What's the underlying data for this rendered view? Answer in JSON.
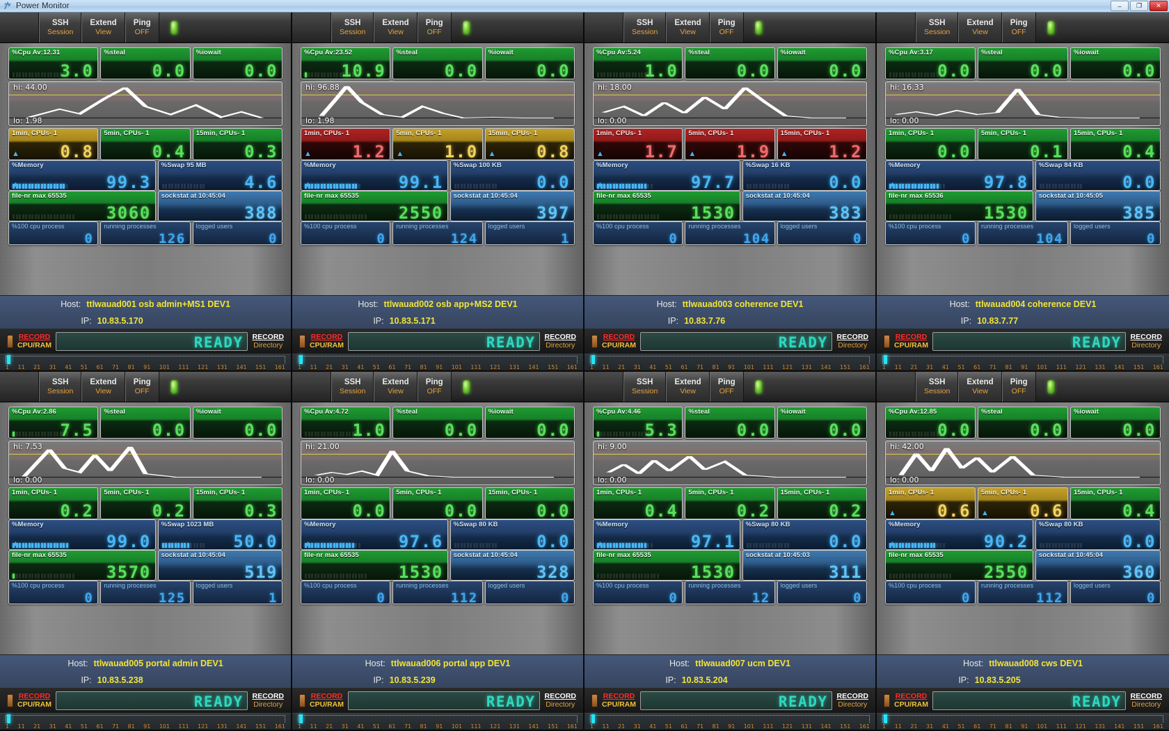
{
  "window": {
    "title": "Power Monitor",
    "icon": "app-icon",
    "buttons": {
      "minimize": "–",
      "maximize": "❐",
      "close": "✕"
    }
  },
  "menu": {
    "items": [
      {
        "top": "SSH",
        "bottom": "Session",
        "name": "ssh-session"
      },
      {
        "top": "Extend",
        "bottom": "View",
        "name": "extend-view"
      },
      {
        "top": "Ping",
        "bottom": "OFF",
        "name": "ping-toggle"
      }
    ],
    "led": "status-led"
  },
  "labels": {
    "steal": "%steal",
    "iowait": "%iowait",
    "load1": "1min, CPUs- 1",
    "load5": "5min, CPUs- 1",
    "load15": "15min, CPUs- 1",
    "memory": "%Memory",
    "cpu100": "%100 cpu process",
    "running": "running processes",
    "logged": "logged users",
    "host": "Host:",
    "ip": "IP:",
    "record_cpu_a": "RECORD",
    "record_cpu_b": "CPU/RAM",
    "record_dir_a": "RECORD",
    "record_dir_b": "Directory",
    "ready": "READY"
  },
  "ruler": {
    "ticks": [
      "1",
      "11",
      "21",
      "31",
      "41",
      "51",
      "61",
      "71",
      "81",
      "91",
      "101",
      "111",
      "121",
      "131",
      "141",
      "151",
      "161"
    ]
  },
  "colors": {
    "green": "#57e05a",
    "yellow": "#f3d25c",
    "red": "#f06a6a",
    "blue": "#49b6f5",
    "accent_yellow": "#f2e536",
    "ready_teal": "#2fd8c0",
    "record_red": "#ff2d2d"
  },
  "panels": [
    {
      "cpu_cap": "%Cpu Av:12.31",
      "cpu_val": "3.0",
      "cpu_bars": 0,
      "cpu_theme": "t-green",
      "steal": "0.0",
      "iowait": "0.0",
      "hi": "hi: 44.00",
      "lo": "lo: 1.98",
      "spark": "4,52 10,40 14,47 19,24 23,8 27,36 32,48 37,34 42,52 46,44 50,53",
      "load": [
        {
          "val": "0.8",
          "theme": "t-yellow",
          "warn": true
        },
        {
          "val": "0.4",
          "theme": "t-green",
          "warn": false
        },
        {
          "val": "0.3",
          "theme": "t-green",
          "warn": false
        }
      ],
      "mem_cap": "%Memory",
      "mem_val": "99.3",
      "mem_bars": 17,
      "mem_warn": true,
      "swap_cap": "%Swap 95 MB",
      "swap_val": "4.6",
      "swap_bars": 0,
      "file_cap": "file-nr max 65535",
      "file_val": "3060",
      "file_bars": 0,
      "sock_cap": "sockstat at 10:45:04",
      "sock_val": "388",
      "cpu100": "0",
      "running": "126",
      "logged": "0",
      "host": "ttlwauad001 osb admin+MS1 DEV1",
      "ip": "10.83.5.170"
    },
    {
      "cpu_cap": "%Cpu Av:23.52",
      "cpu_val": "10.9",
      "cpu_bars": 1,
      "cpu_theme": "t-green",
      "steal": "0.0",
      "iowait": "0.0",
      "hi": "hi: 96.88",
      "lo": "lo: 1.98",
      "spark": "4,50 7,24 9,6 12,30 16,48 20,52 24,36 28,46 32,53 38,52 44,53 50,53",
      "load": [
        {
          "val": "1.2",
          "theme": "t-red",
          "warn": true
        },
        {
          "val": "1.0",
          "theme": "t-yellow",
          "warn": true
        },
        {
          "val": "0.8",
          "theme": "t-yellow",
          "warn": true
        }
      ],
      "mem_cap": "%Memory",
      "mem_val": "99.1",
      "mem_bars": 17,
      "mem_warn": true,
      "swap_cap": "%Swap 100 KB",
      "swap_val": "0.0",
      "swap_bars": 0,
      "file_cap": "file-nr max 65535",
      "file_val": "2550",
      "file_bars": 0,
      "sock_cap": "sockstat at 10:45:04",
      "sock_val": "397",
      "cpu100": "0",
      "running": "124",
      "logged": "1",
      "host": "ttlwauad002 osb app+MS2 DEV1",
      "ip": "10.83.5.171"
    },
    {
      "cpu_cap": "%Cpu Av:5.24",
      "cpu_val": "1.0",
      "cpu_bars": 0,
      "cpu_theme": "t-green",
      "steal": "0.0",
      "iowait": "0.0",
      "hi": "hi: 18.00",
      "lo": "lo: 0.00",
      "spark": "2,45 6,36 10,50 14,30 18,46 22,22 26,40 30,8 34,30 38,50 43,53 50,53",
      "load": [
        {
          "val": "1.7",
          "theme": "t-red",
          "warn": true
        },
        {
          "val": "1.9",
          "theme": "t-red",
          "warn": true
        },
        {
          "val": "1.2",
          "theme": "t-red",
          "warn": true
        }
      ],
      "mem_cap": "%Memory",
      "mem_val": "97.7",
      "mem_bars": 16,
      "mem_warn": true,
      "swap_cap": "%Swap 16 KB",
      "swap_val": "0.0",
      "swap_bars": 0,
      "file_cap": "file-nr max 65535",
      "file_val": "1530",
      "file_bars": 0,
      "sock_cap": "sockstat at 10:45:04",
      "sock_val": "383",
      "cpu100": "0",
      "running": "104",
      "logged": "0",
      "host": "ttlwauad003 coherence DEV1",
      "ip": "10.83.7.76"
    },
    {
      "cpu_cap": "%Cpu Av:3.17",
      "cpu_val": "0.0",
      "cpu_bars": 0,
      "cpu_theme": "t-green",
      "steal": "0.0",
      "iowait": "0.0",
      "hi": "hi: 16.33",
      "lo": "lo: 0.00",
      "spark": "2,48 6,44 10,49 14,42 18,48 22,45 26,10 30,48 34,52 40,53 46,53 50,53",
      "load": [
        {
          "val": "0.0",
          "theme": "t-green",
          "warn": false
        },
        {
          "val": "0.1",
          "theme": "t-green",
          "warn": false
        },
        {
          "val": "0.4",
          "theme": "t-green",
          "warn": false
        }
      ],
      "mem_cap": "%Memory",
      "mem_val": "97.8",
      "mem_bars": 16,
      "mem_warn": true,
      "swap_cap": "%Swap 84 KB",
      "swap_val": "0.0",
      "swap_bars": 0,
      "file_cap": "file-nr max 65536",
      "file_val": "1530",
      "file_bars": 0,
      "sock_cap": "sockstat at 10:45:05",
      "sock_val": "385",
      "cpu100": "0",
      "running": "104",
      "logged": "0",
      "host": "ttlwauad004 coherence DEV1",
      "ip": "10.83.7.77"
    },
    {
      "cpu_cap": "%Cpu Av:2.86",
      "cpu_val": "7.5",
      "cpu_bars": 1,
      "cpu_theme": "t-green",
      "steal": "0.0",
      "iowait": "0.0",
      "hi": "hi: 7.53",
      "lo": "lo: 0.00",
      "spark": "3,52 5,36 8,12 11,40 14,46 17,20 20,44 24,8 27,48 33,53 41,53 50,53",
      "load": [
        {
          "val": "0.2",
          "theme": "t-green",
          "warn": false
        },
        {
          "val": "0.2",
          "theme": "t-green",
          "warn": false
        },
        {
          "val": "0.3",
          "theme": "t-green",
          "warn": false
        }
      ],
      "mem_cap": "%Memory",
      "mem_val": "99.0",
      "mem_bars": 18,
      "mem_warn": true,
      "swap_cap": "%Swap 1023 MB",
      "swap_val": "50.0",
      "swap_bars": 9,
      "file_cap": "file-nr max 65535",
      "file_val": "3570",
      "file_bars": 1,
      "sock_cap": "sockstat at 10:45:04",
      "sock_val": "519",
      "cpu100": "0",
      "running": "125",
      "logged": "1",
      "host": "ttlwauad005 portal admin DEV1",
      "ip": "10.83.5.238"
    },
    {
      "cpu_cap": "%Cpu Av:4.72",
      "cpu_val": "1.0",
      "cpu_bars": 0,
      "cpu_theme": "t-green",
      "steal": "0.0",
      "iowait": "0.0",
      "hi": "hi: 21.00",
      "lo": "lo: 0.00",
      "spark": "3,50 6,46 9,49 12,44 15,50 18,14 21,44 25,51 30,53 38,53 44,53 50,53",
      "load": [
        {
          "val": "0.0",
          "theme": "t-green",
          "warn": false
        },
        {
          "val": "0.0",
          "theme": "t-green",
          "warn": false
        },
        {
          "val": "0.0",
          "theme": "t-green",
          "warn": false
        }
      ],
      "mem_cap": "%Memory",
      "mem_val": "97.6",
      "mem_bars": 16,
      "mem_warn": true,
      "swap_cap": "%Swap 80 KB",
      "swap_val": "0.0",
      "swap_bars": 0,
      "file_cap": "file-nr max 65535",
      "file_val": "1530",
      "file_bars": 0,
      "sock_cap": "sockstat at 10:45:04",
      "sock_val": "328",
      "cpu100": "0",
      "running": "112",
      "logged": "0",
      "host": "ttlwauad006 portal app DEV1",
      "ip": "10.83.5.239"
    },
    {
      "cpu_cap": "%Cpu Av:4.46",
      "cpu_val": "5.3",
      "cpu_bars": 1,
      "cpu_theme": "t-green",
      "steal": "0.0",
      "iowait": "0.0",
      "hi": "hi: 9.00",
      "lo": "lo: 0.00",
      "spark": "3,46 6,34 9,48 12,28 15,44 19,22 22,42 26,30 30,50 36,53 43,53 50,53",
      "load": [
        {
          "val": "0.4",
          "theme": "t-green",
          "warn": false
        },
        {
          "val": "0.2",
          "theme": "t-green",
          "warn": false
        },
        {
          "val": "0.2",
          "theme": "t-green",
          "warn": false
        }
      ],
      "mem_cap": "%Memory",
      "mem_val": "97.1",
      "mem_bars": 16,
      "mem_warn": true,
      "swap_cap": "%Swap 80 KB",
      "swap_val": "0.0",
      "swap_bars": 0,
      "file_cap": "file-nr max 65535",
      "file_val": "1530",
      "file_bars": 0,
      "sock_cap": "sockstat at 10:45:03",
      "sock_val": "311",
      "cpu100": "0",
      "running": "12",
      "logged": "0",
      "host": "ttlwauad007 ucm DEV1",
      "ip": "10.83.5.204"
    },
    {
      "cpu_cap": "%Cpu Av:12.85",
      "cpu_val": "0.0",
      "cpu_bars": 0,
      "cpu_theme": "t-green",
      "steal": "0.0",
      "iowait": "0.0",
      "hi": "hi: 42.00",
      "lo": "lo: 0.00",
      "spark": "3,50 6,18 9,44 12,10 15,40 18,24 21,46 25,22 29,50 35,53 43,53 50,53",
      "load": [
        {
          "val": "0.6",
          "theme": "t-yellow",
          "warn": true
        },
        {
          "val": "0.6",
          "theme": "t-yellow",
          "warn": true
        },
        {
          "val": "0.4",
          "theme": "t-green",
          "warn": false
        }
      ],
      "mem_cap": "%Memory",
      "mem_val": "90.2",
      "mem_bars": 15,
      "mem_warn": true,
      "swap_cap": "%Swap 80 KB",
      "swap_val": "0.0",
      "swap_bars": 0,
      "file_cap": "file-nr max 65535",
      "file_val": "2550",
      "file_bars": 0,
      "sock_cap": "sockstat at 10:45:04",
      "sock_val": "360",
      "cpu100": "0",
      "running": "112",
      "logged": "0",
      "host": "ttlwauad008 cws DEV1",
      "ip": "10.83.5.205"
    }
  ]
}
